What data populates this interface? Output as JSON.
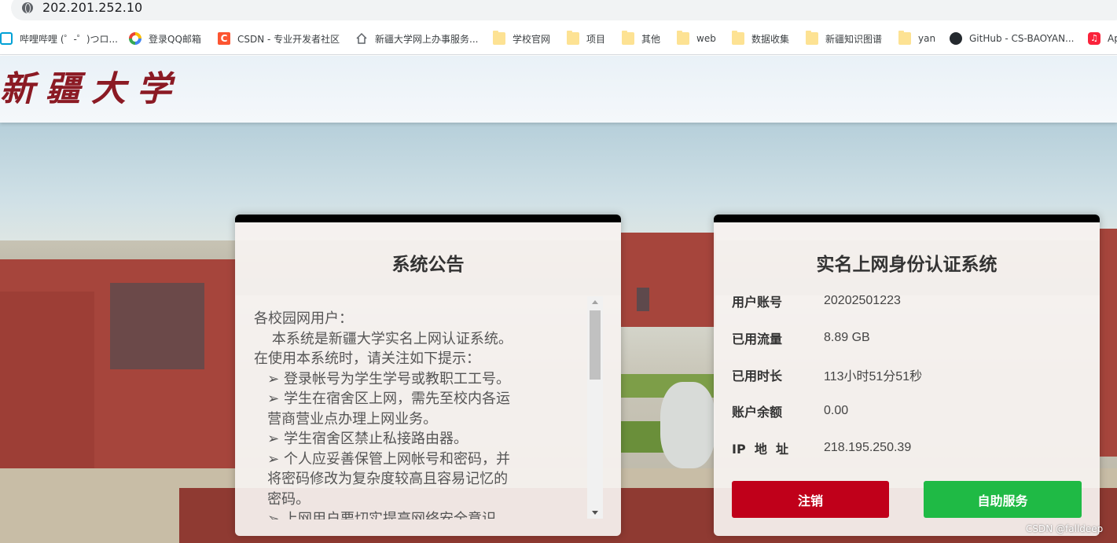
{
  "browser": {
    "url": "202.201.252.10",
    "bookmarks": [
      {
        "label": "哔哩哔哩 (゜-゜)つロ...",
        "icon": "bilibili-icon"
      },
      {
        "label": "登录QQ邮箱",
        "icon": "qq-mail-icon"
      },
      {
        "label": "CSDN - 专业开发者社区",
        "icon": "csdn-icon"
      },
      {
        "label": "新疆大学网上办事服务...",
        "icon": "home-icon"
      },
      {
        "label": "学校官网",
        "icon": "folder-icon"
      },
      {
        "label": "项目",
        "icon": "folder-icon"
      },
      {
        "label": "其他",
        "icon": "folder-icon"
      },
      {
        "label": "web",
        "icon": "folder-icon"
      },
      {
        "label": "数据收集",
        "icon": "folder-icon"
      },
      {
        "label": "新疆知识图谱",
        "icon": "folder-icon"
      },
      {
        "label": "yan",
        "icon": "folder-icon"
      },
      {
        "label": "GitHub - CS-BAOYAN...",
        "icon": "github-icon"
      },
      {
        "label": "Ap",
        "icon": "music-icon"
      }
    ]
  },
  "header": {
    "logo_text": "新疆大学"
  },
  "notice": {
    "title": "系统公告",
    "lines": [
      "各校园网用户：",
      "    本系统是新疆大学实名上网认证系统。",
      "在使用本系统时，请关注如下提示：",
      "   ➢ 登录帐号为学生学号或教职工工号。",
      "   ➢ 学生在宿舍区上网，需先至校内各运",
      "   营商营业点办理上网业务。",
      "   ➢ 学生宿舍区禁止私接路由器。",
      "   ➢ 个人应妥善保管上网帐号和密码，并",
      "   将密码修改为复杂度较高且容易记忆的",
      "   密码。",
      "   ➢ 上网用户要切实提高网络安全意识"
    ]
  },
  "auth": {
    "title": "实名上网身份认证系统",
    "rows": [
      {
        "label": "用户账号",
        "value": "20202501223"
      },
      {
        "label": "已用流量",
        "value": "8.89 GB"
      },
      {
        "label": "已用时长",
        "value": "113小时51分51秒"
      },
      {
        "label": "账户余额",
        "value": "0.00"
      },
      {
        "label": "IP  地  址",
        "value": "218.195.250.39"
      }
    ],
    "logout_label": "注销",
    "self_service_label": "自助服务"
  },
  "colors": {
    "logout": "#c0001a",
    "self_service": "#1fba45",
    "logo": "#8b1a24"
  },
  "watermark": "CSDN @falldeep"
}
